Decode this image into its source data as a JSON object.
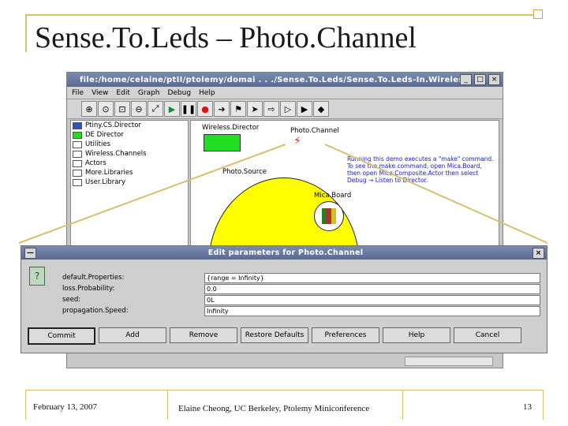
{
  "slide": {
    "title": "Sense.To.Leds – Photo.Channel",
    "footer_date": "February 13, 2007",
    "footer_center": "Elaine Cheong, UC Berkeley, Ptolemy Miniconference",
    "page_number": "13"
  },
  "app_window": {
    "title": "file:/home/celaine/ptII/ptolemy/domai . . ./Sense.To.Leds/Sense.To.Leds-In.Wireless.xml",
    "menu": [
      "File",
      "View",
      "Edit",
      "Graph",
      "Debug",
      "Help"
    ],
    "library_items": [
      "Ptiny.CS.Director",
      "DE Director",
      "Utilities",
      "Wireless.Channels",
      "Actors",
      "More.Libraries",
      "User.Library"
    ],
    "canvas": {
      "director_label": "Wireless.Director",
      "channel_label": "Photo.Channel",
      "source_label": "Photo.Source",
      "board_label": "Mica.Board",
      "note": "Running this demo executes a \"make\" command. To see the make command, open Mica.Board, then open Mica.Composite.Actor then select Debug → Listen to Director."
    },
    "colors": {
      "director": "#22dd22",
      "source": "#ffff00",
      "channel_icon": "#ff2020"
    }
  },
  "dialog": {
    "title": "Edit parameters for Photo.Channel",
    "params": [
      {
        "label": "default.Properties:",
        "value": "{range = Infinity}"
      },
      {
        "label": "loss.Probability:",
        "value": "0.0"
      },
      {
        "label": "seed:",
        "value": "0L"
      },
      {
        "label": "propagation.Speed:",
        "value": "Infinity"
      }
    ],
    "buttons": [
      "Commit",
      "Add",
      "Remove",
      "Restore Defaults",
      "Preferences",
      "Help",
      "Cancel"
    ]
  }
}
